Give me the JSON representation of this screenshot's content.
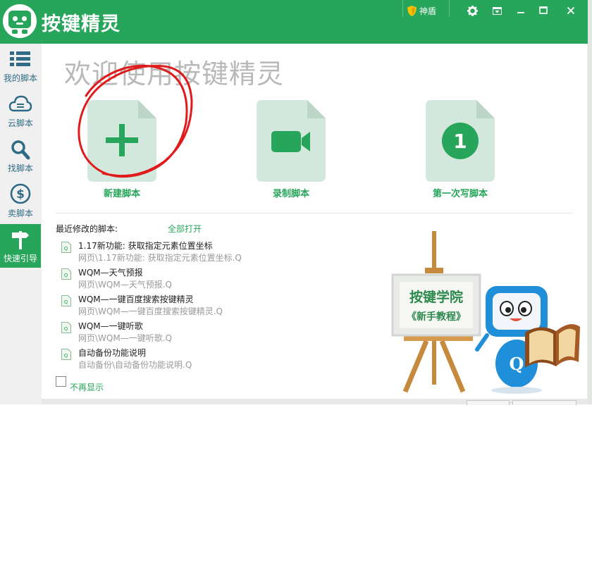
{
  "app": {
    "title": "按键精灵"
  },
  "titlebar": {
    "shield_label": "神盾",
    "buttons": {
      "settings": "gear",
      "menu": "dropdown",
      "minimize": "–",
      "maximize": "☐",
      "close": "✕"
    }
  },
  "sidebar": {
    "items": [
      {
        "label": "我的脚本",
        "icon": "list-icon"
      },
      {
        "label": "云脚本",
        "icon": "cloud-icon"
      },
      {
        "label": "找脚本",
        "icon": "search-icon"
      },
      {
        "label": "卖脚本",
        "icon": "dollar-icon"
      },
      {
        "label": "快速引导",
        "icon": "signpost-icon",
        "active": true
      }
    ]
  },
  "main": {
    "welcome": "欢迎使用按键精灵",
    "cards": [
      {
        "label": "新建脚本",
        "icon": "plus-icon"
      },
      {
        "label": "录制脚本",
        "icon": "video-camera-icon"
      },
      {
        "label": "第一次写脚本",
        "icon": "number-one-icon",
        "glyph": "1"
      }
    ],
    "recent": {
      "title": "最近修改的脚本:",
      "open_all": "全部打开",
      "files": [
        {
          "name": "1.17新功能: 获取指定元素位置坐标",
          "path": "网页\\1.17新功能: 获取指定元素位置坐标.Q"
        },
        {
          "name": "WQM—天气预报",
          "path": "网页\\WQM—天气预报.Q"
        },
        {
          "name": "WQM—一键百度搜索按键精灵",
          "path": "网页\\WQM—一键百度搜索按键精灵.Q"
        },
        {
          "name": "WQM—一键听歌",
          "path": "网页\\WQM—一键听歌.Q"
        },
        {
          "name": "自动备份功能说明",
          "path": "自动备份\\自动备份功能说明.Q"
        }
      ]
    },
    "no_show": "不再显示",
    "promo": {
      "line1": "按键学院",
      "line2": "《新手教程》",
      "badge": "Q"
    }
  },
  "colors": {
    "brand": "#27a55a",
    "annotation": "#e01b1b"
  }
}
